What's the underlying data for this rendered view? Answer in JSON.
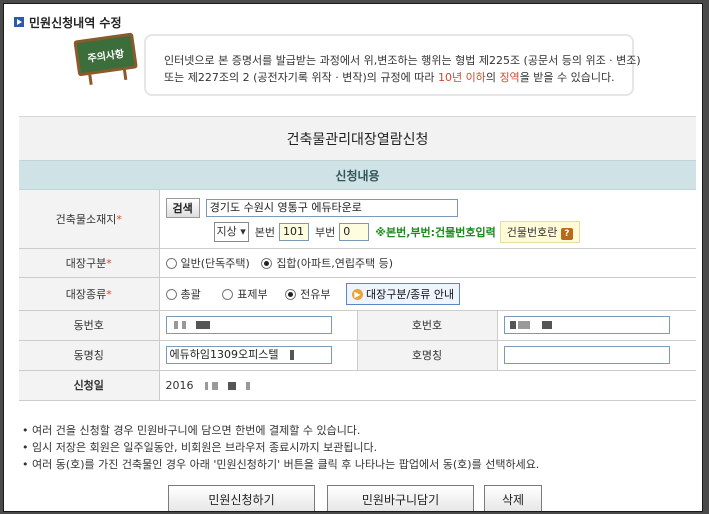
{
  "header": {
    "title": "민원신청내역 수정"
  },
  "notice": {
    "board_label": "주의사항",
    "line1_pre": "인터넷으로 본 증명서를 발급받는 과정에서 위,변조하는 행위는 형법 제225조 (공문서 등의 위조 · 변조)",
    "line2_pre": "또는 제227조의 2 (공전자기록 위작 · 변작)의 규정에 따라 ",
    "line2_red": "10년 이하",
    "line2_mid": "의 ",
    "line2_red2": "징역",
    "line2_post": "을 받을 수 있습니다."
  },
  "form": {
    "title": "건축물관리대장열람신청",
    "subtitle": "신청내용",
    "location": {
      "label": "건축물소재지",
      "search_button": "검색",
      "address": "경기도 수원시 영통구 에듀타운로",
      "land_type": "지상",
      "main_no_label": "본번",
      "main_no": "101",
      "sub_no_label": "부번",
      "sub_no": "0",
      "hint": "※본번,부번:건물번호입력",
      "help_button": "건물번호란"
    },
    "ledger_class": {
      "label": "대장구분",
      "options": [
        "일반(단독주택)",
        "집합(아파트,연립주택 등)"
      ],
      "selected": 1
    },
    "ledger_type": {
      "label": "대장종류",
      "options": [
        "총괄",
        "표제부",
        "전유부"
      ],
      "selected": 2,
      "guide_button": "대장구분/종류 안내"
    },
    "dong_no": {
      "label": "동번호"
    },
    "ho_no": {
      "label": "호번호"
    },
    "dong_name": {
      "label": "동명칭",
      "value": "에듀하임1309오피스텔"
    },
    "ho_name": {
      "label": "호명칭"
    },
    "apply_date": {
      "label": "신청일",
      "value": "2016"
    }
  },
  "notes": [
    "• 여러 건을 신청할 경우 민원바구니에 담으면 한번에 결제할 수 있습니다.",
    "• 임시 저장은 회원은 일주일동안, 비회원은 브라우저 종료시까지 보관됩니다.",
    "• 여러 동(호)를 가진 건축물인 경우 아래 '민원신청하기' 버튼을 클릭 후 나타나는 팝업에서 동(호)를 선택하세요."
  ],
  "buttons": {
    "apply": "민원신청하기",
    "basket": "민원바구니담기",
    "delete": "삭제"
  }
}
